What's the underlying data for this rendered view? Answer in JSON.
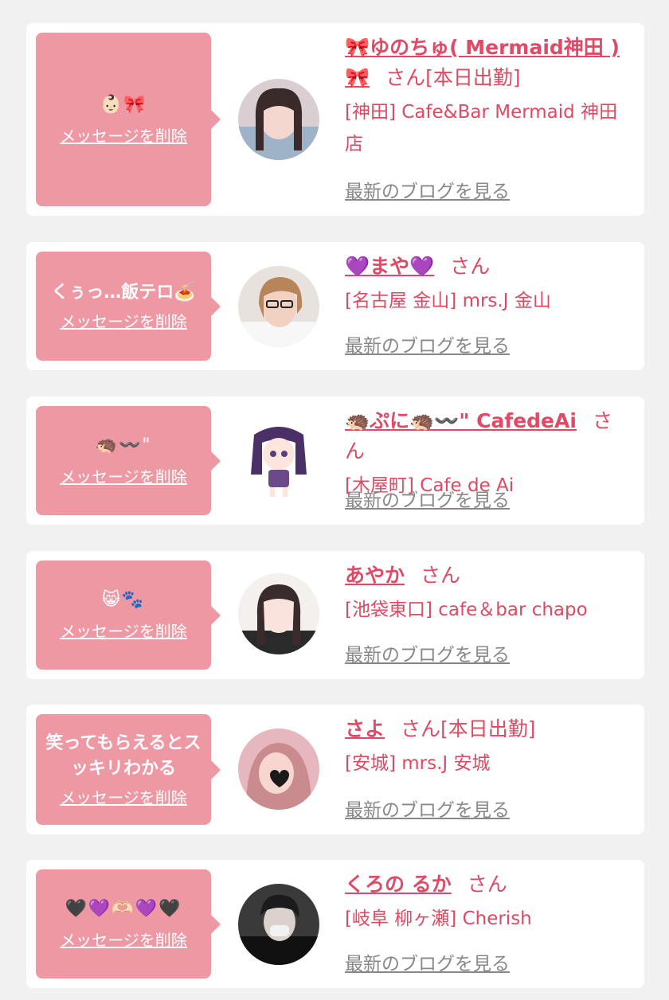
{
  "messages": [
    {
      "bubble_text": "👶🏻🎀",
      "bubble_is_emoji": true,
      "delete_label": "メッセージを削除",
      "name": "🎀ゆのちゅ( Mermaid神田 )🎀",
      "honorific": "さん[本日出勤]",
      "shop": "[神田] Cafe&Bar Mermaid 神田店",
      "blog_link": "最新のブログを見る",
      "avatar_icon": "cast-photo-avatar"
    },
    {
      "bubble_text": "くぅっ…飯テロ🍝",
      "bubble_is_emoji": false,
      "delete_label": "メッセージを削除",
      "name": "💜まや💜",
      "honorific": "さん",
      "shop": "[名古屋 金山] mrs.J 金山",
      "blog_link": "最新のブログを見る",
      "avatar_icon": "cast-photo-avatar"
    },
    {
      "bubble_text": "🦔〰️\"",
      "bubble_is_emoji": true,
      "delete_label": "メッセージを削除",
      "name": "🦔ぷに🦔〰️\" CafedeAi",
      "honorific": "さん",
      "shop": "[木屋町] Cafe de Ai",
      "blog_link": "最新のブログを見る",
      "avatar_icon": "anime-character-avatar"
    },
    {
      "bubble_text": "😸🐾",
      "bubble_is_emoji": true,
      "delete_label": "メッセージを削除",
      "name": "あやか",
      "honorific": "さん",
      "shop": "[池袋東口] cafe＆bar chapo",
      "blog_link": "最新のブログを見る",
      "avatar_icon": "cast-photo-avatar"
    },
    {
      "bubble_text": "笑ってもらえるとスッキリわかる",
      "bubble_is_emoji": false,
      "delete_label": "メッセージを削除",
      "name": "さよ",
      "honorific": "さん[本日出勤]",
      "shop": "[安城] mrs.J 安城",
      "blog_link": "最新のブログを見る",
      "avatar_icon": "cast-photo-avatar"
    },
    {
      "bubble_text": "🖤💜🫶🏻💜🖤",
      "bubble_is_emoji": true,
      "delete_label": "メッセージを削除",
      "name": "くろの るか",
      "honorific": "さん",
      "shop": "[岐阜 柳ヶ瀬] Cherish",
      "blog_link": "最新のブログを見る",
      "avatar_icon": "cast-photo-avatar"
    }
  ],
  "colors": {
    "background": "#f1f1f1",
    "card": "#ffffff",
    "bubble": "#ee98a4",
    "accent": "#dd4a63",
    "muted_link": "#888888"
  }
}
